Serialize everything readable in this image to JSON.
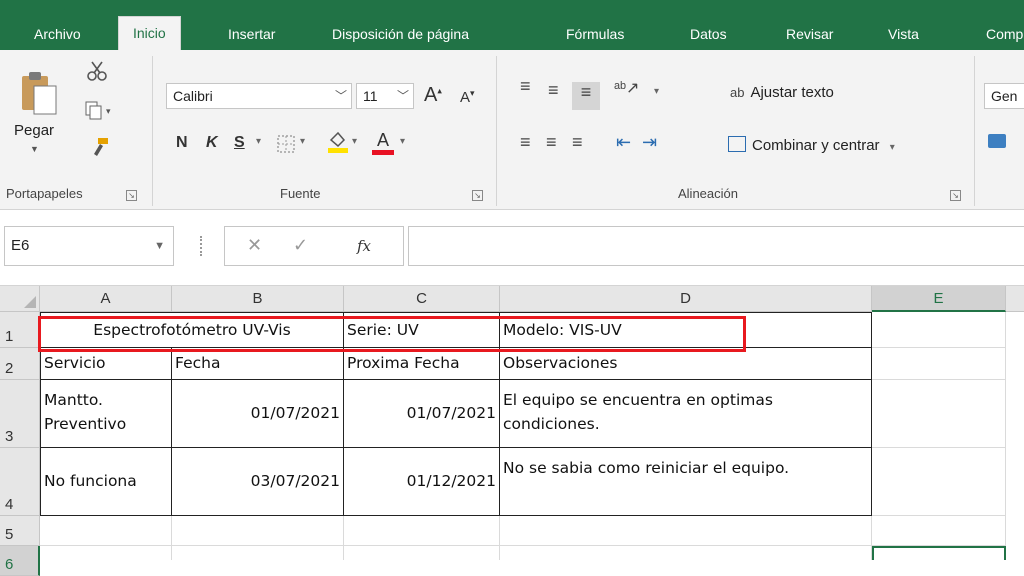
{
  "tabs": [
    "Archivo",
    "Inicio",
    "Insertar",
    "Disposición de página",
    "Fórmulas",
    "Datos",
    "Revisar",
    "Vista",
    "Comp"
  ],
  "ribbon": {
    "clipboard": {
      "paste_label": "Pegar",
      "group_label": "Portapapeles"
    },
    "font": {
      "font_name": "Calibri",
      "font_size": "11",
      "increase": "A",
      "decrease": "A",
      "bold": "N",
      "italic": "K",
      "underline": "S",
      "group_label": "Fuente"
    },
    "alignment": {
      "wrap_text": "Ajustar texto",
      "wrap_text_icon_text": "ab",
      "merge_center": "Combinar y centrar",
      "group_label": "Alineación"
    },
    "number": {
      "format": "Gen"
    }
  },
  "formula_bar": {
    "name_box": "E6",
    "fx": "fx",
    "formula": ""
  },
  "columns": [
    "A",
    "B",
    "C",
    "D",
    "E"
  ],
  "rows": [
    "1",
    "2",
    "3",
    "4",
    "5",
    "6"
  ],
  "cells": {
    "r1": {
      "a": "Espectrofotómetro UV-Vis",
      "c": "Serie: UV",
      "d": "Modelo: VIS-UV"
    },
    "r2": {
      "a": "Servicio",
      "b": "Fecha",
      "c": "Proxima Fecha",
      "d": "Observaciones"
    },
    "r3": {
      "a": "Mantto. Preventivo",
      "b": "01/07/2021",
      "c": "01/07/2021",
      "d": "El equipo se encuentra en optimas condiciones."
    },
    "r4": {
      "a": "No funciona",
      "b": "03/07/2021",
      "c": "01/12/2021",
      "d": "No se sabia como reiniciar el equipo."
    }
  },
  "colors": {
    "excel_green": "#217346",
    "highlight_red": "#e8191f",
    "font_color_red": "#e81123",
    "fill_yellow": "#ffe100"
  }
}
